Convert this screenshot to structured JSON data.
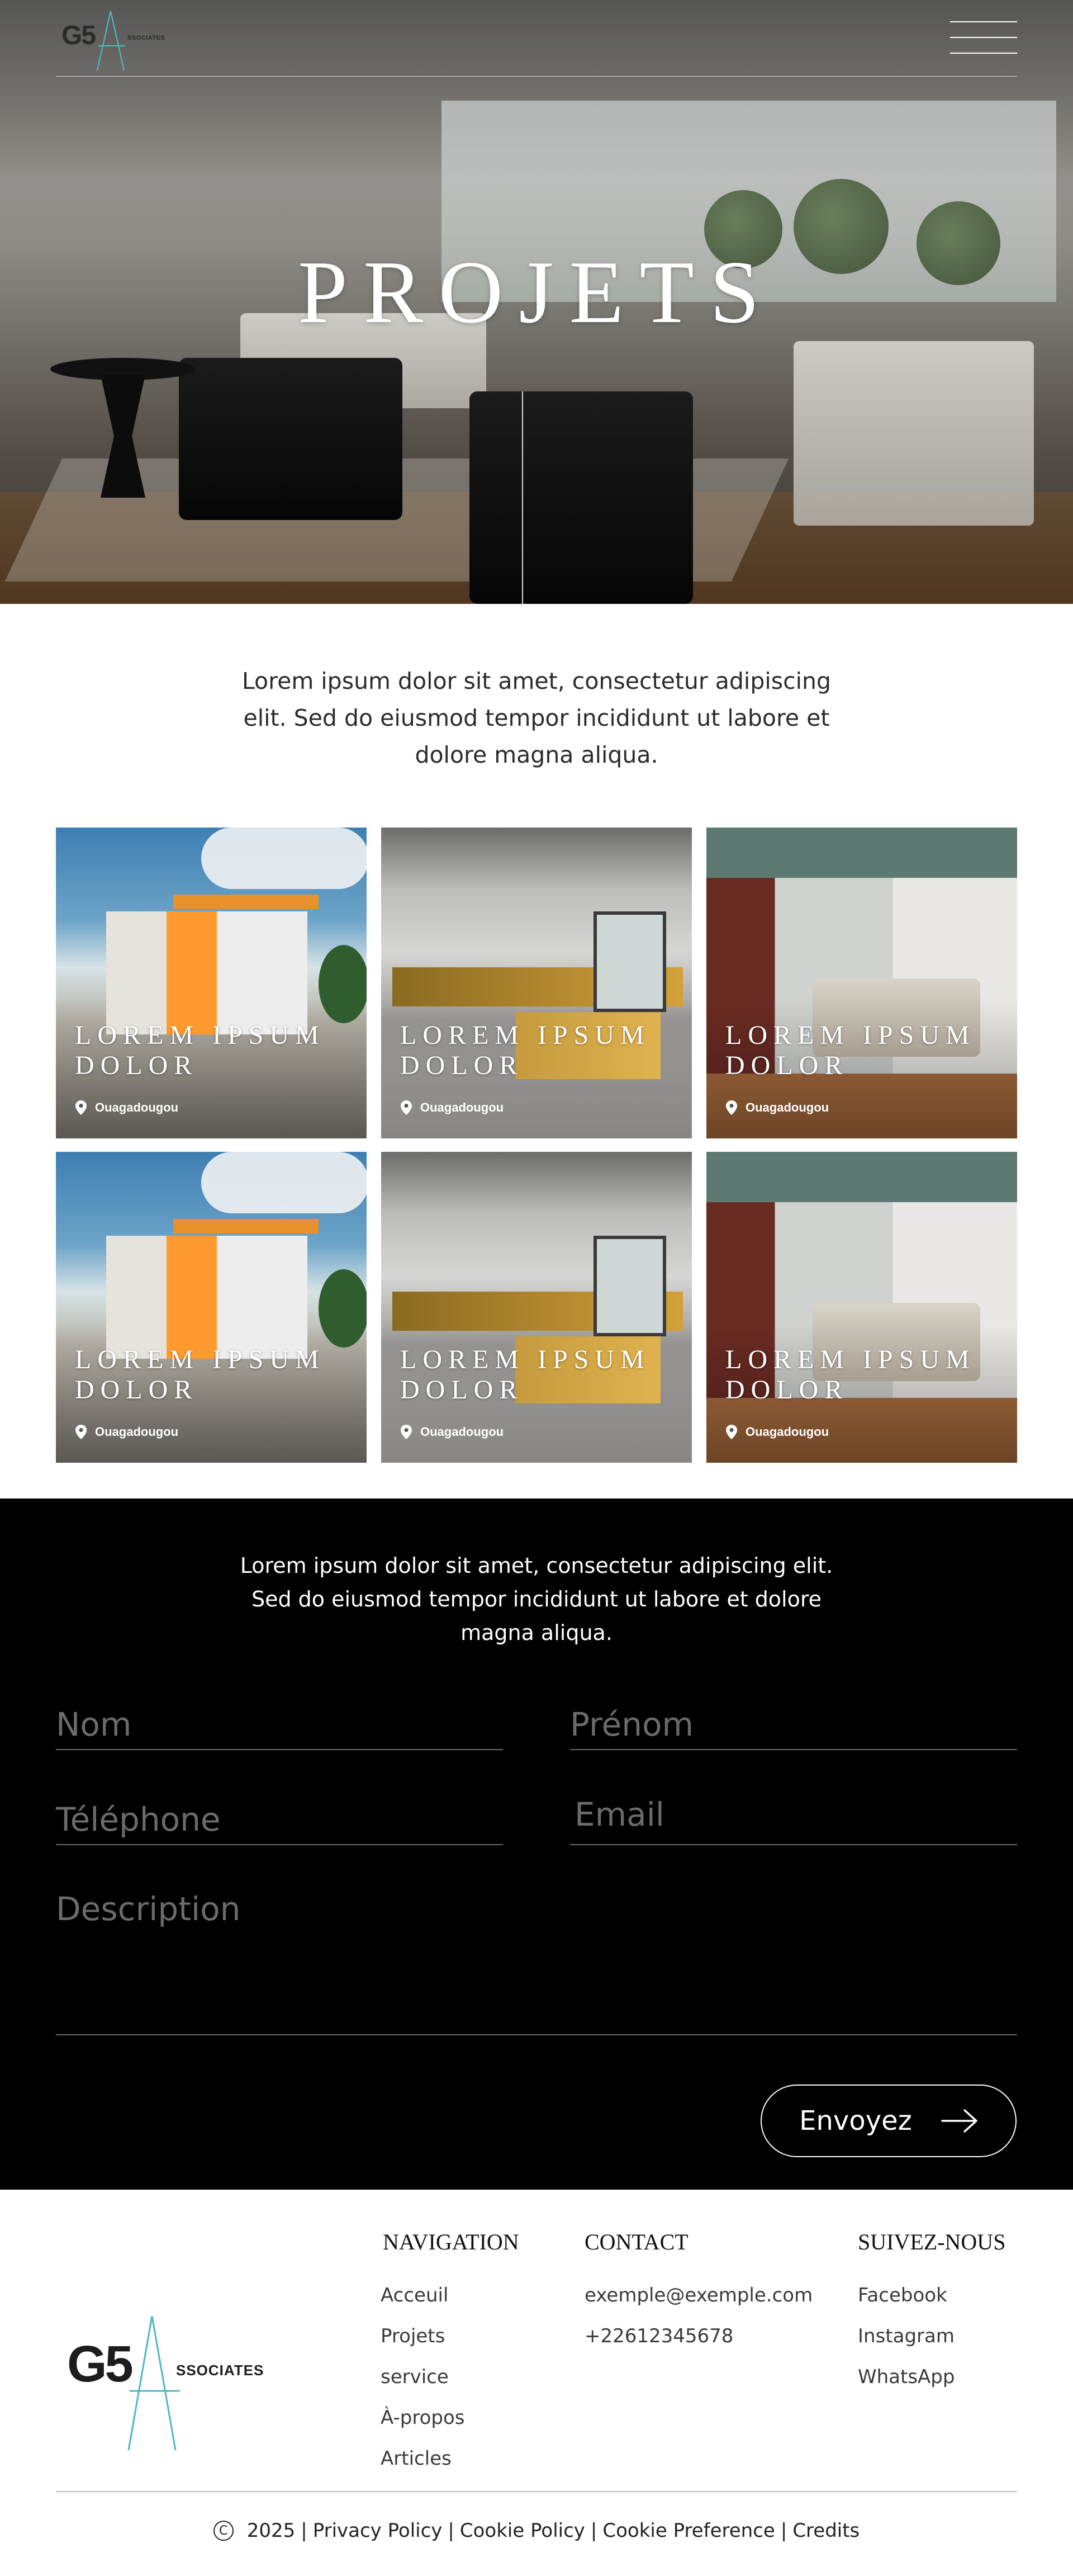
{
  "header": {
    "logo_main": "G5",
    "logo_sub": "SSOCIATES",
    "menu_icon": "hamburger-icon"
  },
  "hero": {
    "title": "PROJETS"
  },
  "intro": {
    "text": "Lorem ipsum dolor sit amet, consectetur adipiscing elit. Sed do eiusmod tempor incididunt ut labore et dolore magna aliqua."
  },
  "projects": [
    {
      "title": "LOREM IPSUM DOLOR",
      "location": "Ouagadougou",
      "image": "modern-house-exterior"
    },
    {
      "title": "LOREM IPSUM DOLOR",
      "location": "Ouagadougou",
      "image": "modern-kitchen-interior"
    },
    {
      "title": "LOREM IPSUM DOLOR",
      "location": "Ouagadougou",
      "image": "bedroom-interior"
    },
    {
      "title": "LOREM IPSUM DOLOR",
      "location": "Ouagadougou",
      "image": "modern-house-exterior"
    },
    {
      "title": "LOREM IPSUM DOLOR",
      "location": "Ouagadougou",
      "image": "modern-kitchen-interior"
    },
    {
      "title": "LOREM IPSUM DOLOR",
      "location": "Ouagadougou",
      "image": "bedroom-interior"
    }
  ],
  "contact": {
    "lead": "Lorem ipsum dolor sit amet, consectetur adipiscing elit. Sed do eiusmod tempor incididunt ut labore et dolore magna aliqua.",
    "fields": {
      "nom": {
        "placeholder": "Nom",
        "value": ""
      },
      "prenom": {
        "placeholder": "Prénom",
        "value": ""
      },
      "telephone": {
        "placeholder": "Téléphone",
        "value": ""
      },
      "email": {
        "placeholder": "Email",
        "value": ""
      },
      "description": {
        "placeholder": "Description",
        "value": ""
      }
    },
    "submit_label": "Envoyez"
  },
  "footer": {
    "logo_main": "G5",
    "logo_sub": "SSOCIATES",
    "navigation": {
      "heading": "NAVIGATION",
      "items": [
        "Acceuil",
        "Projets",
        "service",
        "À-propos",
        "Articles"
      ]
    },
    "contact": {
      "heading": "CONTACT",
      "email": "exemple@exemple.com",
      "phone": "+22612345678"
    },
    "social": {
      "heading": "SUIVEZ-NOUS",
      "items": [
        "Facebook",
        "Instagram",
        "WhatsApp"
      ]
    },
    "copyright": {
      "year": "2025",
      "links": [
        "Privacy Policy",
        "Cookie Policy",
        "Cookie Preference",
        "Credits"
      ]
    }
  },
  "colors": {
    "accent_teal": "#4fb6c4",
    "contact_bg": "#000000",
    "placeholder": "#6b6b6b"
  }
}
